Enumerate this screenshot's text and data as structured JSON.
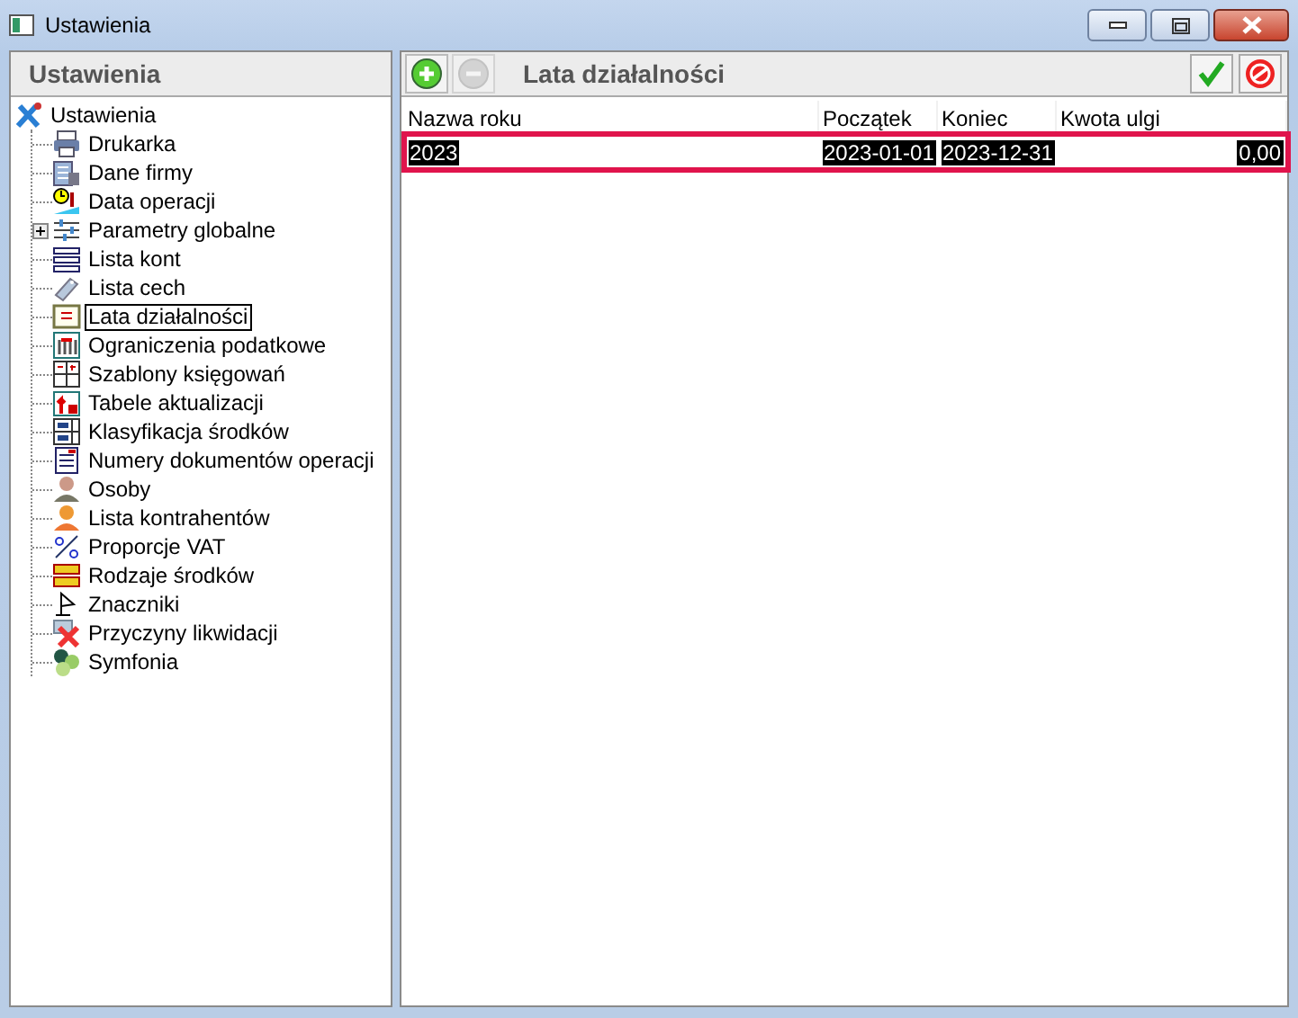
{
  "window": {
    "title": "Ustawienia"
  },
  "sidebar": {
    "title": "Ustawienia",
    "tree": [
      {
        "label": "Ustawienia",
        "selected": false,
        "children": [
          {
            "label": "Drukarka",
            "selected": false
          },
          {
            "label": "Dane firmy",
            "selected": false
          },
          {
            "label": "Data operacji",
            "selected": false
          },
          {
            "label": "Parametry globalne",
            "selected": false,
            "expanded": false
          },
          {
            "label": "Lista kont",
            "selected": false
          },
          {
            "label": "Lista cech",
            "selected": false
          },
          {
            "label": "Lata działalności",
            "selected": true
          },
          {
            "label": "Ograniczenia podatkowe",
            "selected": false
          },
          {
            "label": "Szablony księgowań",
            "selected": false
          },
          {
            "label": "Tabele aktualizacji",
            "selected": false
          },
          {
            "label": "Klasyfikacja środków",
            "selected": false
          },
          {
            "label": "Numery dokumentów operacji",
            "selected": false
          },
          {
            "label": "Osoby",
            "selected": false
          },
          {
            "label": "Lista kontrahentów",
            "selected": false
          },
          {
            "label": "Proporcje VAT",
            "selected": false
          },
          {
            "label": "Rodzaje środków",
            "selected": false
          },
          {
            "label": "Znaczniki",
            "selected": false
          },
          {
            "label": "Przyczyny likwidacji",
            "selected": false
          },
          {
            "label": "Symfonia",
            "selected": false
          }
        ]
      }
    ]
  },
  "panel": {
    "title": "Lata działalności",
    "toolbar": [
      {
        "kind": "add",
        "disabled": false
      },
      {
        "kind": "remove",
        "disabled": true
      }
    ],
    "actions": [
      {
        "kind": "confirm"
      },
      {
        "kind": "cancel"
      }
    ],
    "table": {
      "columns": [
        "Nazwa roku",
        "Początek",
        "Koniec",
        "Kwota ulgi"
      ],
      "rows": [
        {
          "selected": true,
          "cells": [
            "2023",
            "2023-01-01",
            "2023-12-31",
            "0,00"
          ]
        }
      ]
    }
  }
}
